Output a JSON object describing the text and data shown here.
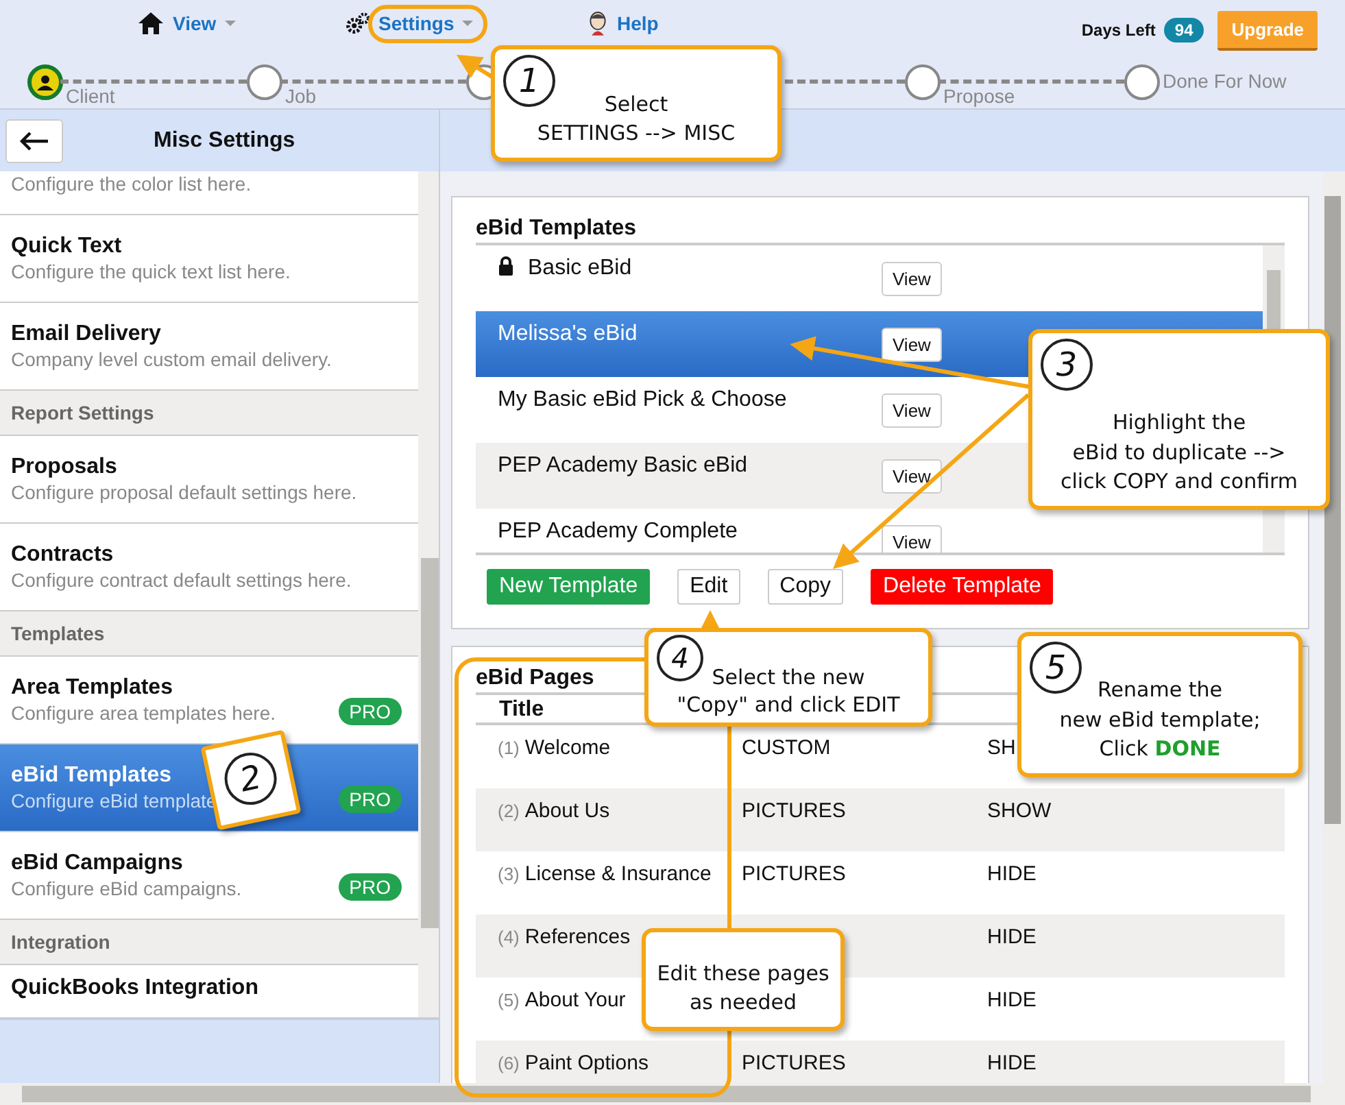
{
  "nav": {
    "items": [
      {
        "label": "View",
        "dropdown": true
      },
      {
        "label": "Settings",
        "dropdown": true
      },
      {
        "label": "Help",
        "dropdown": false
      }
    ],
    "days_left_label": "Days Left",
    "days_left": "94",
    "upgrade_button": "Upgrade"
  },
  "steps": [
    {
      "label": "Client",
      "selected": true
    },
    {
      "label": "Job",
      "selected": false
    },
    {
      "selected": false
    },
    {
      "label": "Propose",
      "selected": false
    },
    {
      "label": "Done For Now",
      "selected": false
    }
  ],
  "sidebar": {
    "title": "Misc Settings",
    "items": [
      {
        "kind": "item",
        "description": "Configure the color list here."
      },
      {
        "kind": "item",
        "title": "Quick Text",
        "description": "Configure the quick text list here.",
        "selected": false
      },
      {
        "kind": "item",
        "title": "Email Delivery",
        "description": "Company level custom email delivery.",
        "selected": false
      },
      {
        "kind": "section",
        "title": "Report Settings"
      },
      {
        "kind": "item",
        "title": "Proposals",
        "description": "Configure proposal default settings here.",
        "selected": false
      },
      {
        "kind": "item",
        "title": "Contracts",
        "description": "Configure contract default settings here.",
        "selected": false
      },
      {
        "kind": "section",
        "title": "Templates"
      },
      {
        "kind": "item",
        "title": "Area Templates",
        "description": "Configure area templates here.",
        "badge": "PRO",
        "selected": false
      },
      {
        "kind": "item",
        "title": "eBid Templates",
        "description": "Configure eBid template",
        "badge": "PRO",
        "selected": true
      },
      {
        "kind": "item",
        "title": "eBid Campaigns",
        "description": "Configure eBid campaigns.",
        "badge": "PRO",
        "selected": false
      },
      {
        "kind": "section",
        "title": "Integration"
      },
      {
        "kind": "item",
        "title": "QuickBooks Integration",
        "selected": false
      }
    ]
  },
  "templates": {
    "title": "eBid Templates",
    "rows": [
      {
        "name": "Basic eBid",
        "locked": true,
        "selected": false,
        "view": "View"
      },
      {
        "name": "Melissa's eBid",
        "locked": false,
        "selected": true,
        "view": "View"
      },
      {
        "name": "My Basic eBid Pick & Choose",
        "locked": false,
        "selected": false,
        "view": "View"
      },
      {
        "name": "PEP Academy Basic eBid",
        "locked": false,
        "selected": false,
        "view": "View"
      },
      {
        "name": "PEP Academy Complete",
        "locked": false,
        "selected": false,
        "view": "View"
      }
    ],
    "buttons": [
      {
        "label": "New Template",
        "kind": "add"
      },
      {
        "label": "Edit",
        "kind": "plain"
      },
      {
        "label": "Copy",
        "kind": "plain"
      },
      {
        "label": "Delete Template",
        "kind": "delete"
      }
    ]
  },
  "pages": {
    "title": "eBid Pages",
    "column_1": "Title",
    "rows": [
      {
        "number": "(1)",
        "title": "Welcome",
        "type": "CUSTOM",
        "visibility": "SH"
      },
      {
        "number": "(2)",
        "title": "About Us",
        "type": "PICTURES",
        "visibility": "SHOW"
      },
      {
        "number": "(3)",
        "title": "License & Insurance",
        "type": "PICTURES",
        "visibility": "HIDE"
      },
      {
        "number": "(4)",
        "title": "References",
        "visibility": "HIDE"
      },
      {
        "number": "(5)",
        "title": "About Your",
        "visibility": "HIDE"
      },
      {
        "number": "(6)",
        "title": "Paint Options",
        "type": "PICTURES",
        "visibility": "HIDE"
      }
    ]
  },
  "callouts": [
    {
      "number": "1",
      "lines": [
        "Select",
        "SETTINGS --> MISC"
      ]
    },
    {
      "number": "2"
    },
    {
      "number": "3",
      "lines": [
        "Highlight the",
        "eBid to duplicate -->",
        "click COPY and confirm"
      ]
    },
    {
      "number": "4",
      "lines": [
        "Select the new",
        "\"Copy\" and click EDIT"
      ]
    },
    {
      "number": "5",
      "lines": [
        "Rename the",
        "new eBid template;",
        "Click **DONE**"
      ]
    },
    {
      "lines": [
        "Edit these pages",
        "as needed"
      ]
    }
  ]
}
